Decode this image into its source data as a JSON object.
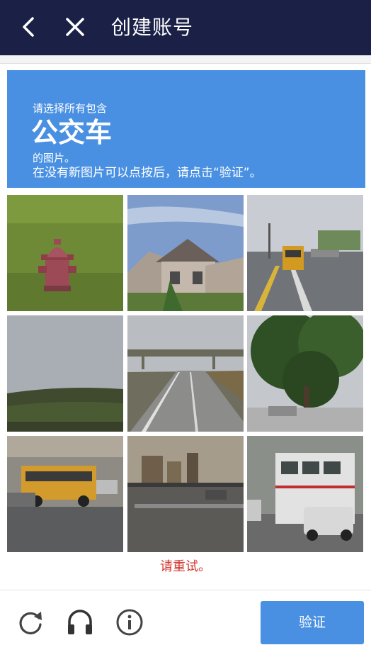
{
  "topbar": {
    "title": "创建账号",
    "back_icon": "chevron-left-icon",
    "close_icon": "close-icon"
  },
  "captcha": {
    "instruction_pre": "请选择所有包含",
    "target": "公交车",
    "instruction_post": "的图片。",
    "instruction_note": "在没有新图片可以点按后，请点击“验证”。",
    "error_text": "请重试。",
    "tiles": [
      {
        "content": "fire-hydrant"
      },
      {
        "content": "house"
      },
      {
        "content": "school-bus-on-road"
      },
      {
        "content": "field-and-sky"
      },
      {
        "content": "highway"
      },
      {
        "content": "tree"
      },
      {
        "content": "school-bus"
      },
      {
        "content": "street-traffic"
      },
      {
        "content": "white-bus"
      }
    ]
  },
  "footer": {
    "reload_icon": "reload-icon",
    "audio_icon": "headphones-icon",
    "info_icon": "info-icon",
    "verify_label": "验证"
  },
  "colors": {
    "topbar_bg": "#1b2047",
    "accent": "#4a90e2",
    "error": "#d0352b"
  }
}
